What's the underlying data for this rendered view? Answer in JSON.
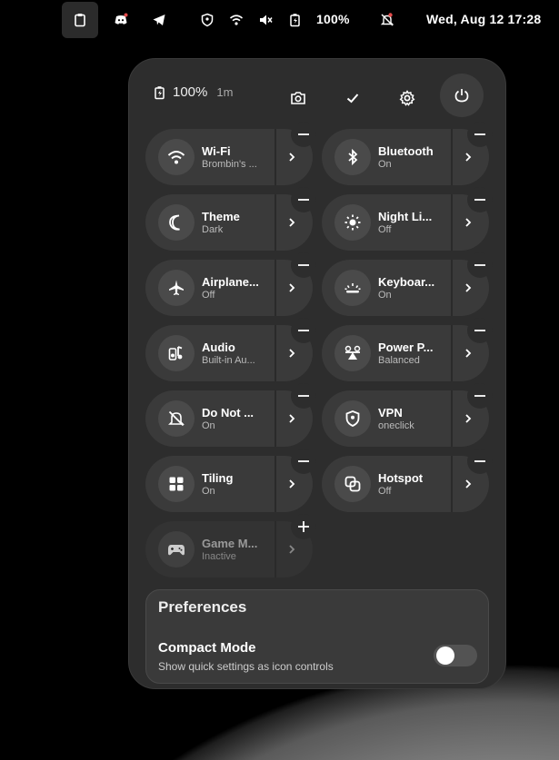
{
  "topbar": {
    "battery_pct": "100%",
    "datetime": "Wed, Aug 12  17:28",
    "icons": [
      "clipboard-icon",
      "discord-icon",
      "telegram-icon",
      "vpn-shield-icon",
      "wifi-icon",
      "muted-volume-icon",
      "battery-icon",
      "do-not-disturb-icon"
    ],
    "notification_dot_color": "#e34b4b"
  },
  "panel": {
    "battery_pct": "100%",
    "battery_time": "1m",
    "header_buttons": [
      "screenshot-icon",
      "check-icon",
      "settings-icon",
      "power-icon"
    ]
  },
  "tiles": [
    {
      "title": "Wi-Fi",
      "subtitle": "Brombin's ...",
      "icon": "wifi-icon",
      "badge": "minus"
    },
    {
      "title": "Bluetooth",
      "subtitle": "On",
      "icon": "bluetooth-icon",
      "badge": "minus"
    },
    {
      "title": "Theme",
      "subtitle": "Dark",
      "icon": "moon-icon",
      "badge": "minus"
    },
    {
      "title": "Night Li...",
      "subtitle": "Off",
      "icon": "sun-icon",
      "badge": "minus"
    },
    {
      "title": "Airplane...",
      "subtitle": "Off",
      "icon": "airplane-icon",
      "badge": "minus"
    },
    {
      "title": "Keyboar...",
      "subtitle": "On",
      "icon": "keyboard-backlight-icon",
      "badge": "minus"
    },
    {
      "title": "Audio",
      "subtitle": "Built-in Au...",
      "icon": "audio-icon",
      "badge": "minus"
    },
    {
      "title": "Power P...",
      "subtitle": "Balanced",
      "icon": "power-profile-icon",
      "badge": "minus"
    },
    {
      "title": "Do Not ...",
      "subtitle": "On",
      "icon": "bell-off-icon",
      "badge": "minus"
    },
    {
      "title": "VPN",
      "subtitle": "oneclick",
      "icon": "shield-icon",
      "badge": "minus"
    },
    {
      "title": "Tiling",
      "subtitle": "On",
      "icon": "grid-icon",
      "badge": "minus"
    },
    {
      "title": "Hotspot",
      "subtitle": "Off",
      "icon": "hotspot-icon",
      "badge": "minus"
    },
    {
      "title": "Game M...",
      "subtitle": "Inactive",
      "icon": "gamepad-icon",
      "badge": "plus"
    }
  ],
  "preferences": {
    "title": "Preferences",
    "compact_title": "Compact Mode",
    "compact_desc": "Show quick settings as icon controls",
    "compact_enabled": false
  }
}
